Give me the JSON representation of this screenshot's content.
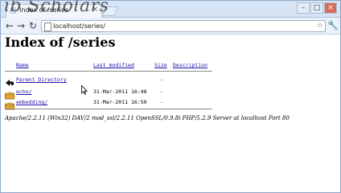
{
  "watermark": "ib Scholars",
  "tab": {
    "title": "Index of /series",
    "close": "×"
  },
  "window_controls": {
    "minimize": "–",
    "maximize": "□",
    "close": "×"
  },
  "toolbar": {
    "back": "←",
    "forward": "→",
    "reload": "↻",
    "url": "localhost/series/",
    "star": "☆",
    "wrench": "🔧"
  },
  "page": {
    "title": "Index of /series",
    "columns": {
      "name": "Name",
      "last_modified": "Last modified",
      "size": "Size",
      "description": "Description"
    },
    "parent": {
      "name": "Parent Directory",
      "size": "-"
    },
    "rows": [
      {
        "name": "echo/",
        "last_modified": "31-Mar-2011 16:48",
        "size": "-"
      },
      {
        "name": "embedding/",
        "last_modified": "31-Mar-2011 16:50",
        "size": "-"
      }
    ],
    "address": "Apache/2.2.11 (Win32) DAV/2 mod_ssl/2.2.11 OpenSSL/0.9.8i PHP/5.2.9 Server at localhost Port 80"
  }
}
